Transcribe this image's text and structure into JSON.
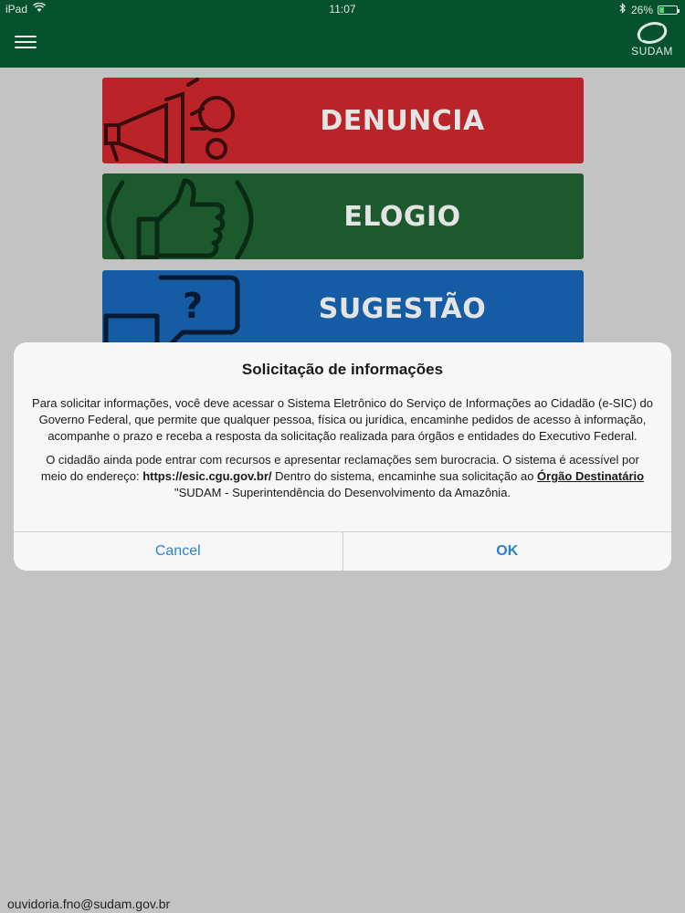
{
  "status_bar": {
    "carrier": "iPad",
    "time": "11:07",
    "battery": "26%",
    "battery_level": 0.26
  },
  "header": {
    "menu_icon": "hamburger-menu-icon",
    "logo_text": "SUDAM"
  },
  "tiles": [
    {
      "label": "DENUNCIA",
      "icon": "megaphone-icon",
      "color": "#ba2428"
    },
    {
      "label": "ELOGIO",
      "icon": "thumbs-up-icon",
      "color": "#1c5a2d"
    },
    {
      "label": "SUGESTÃO",
      "icon": "question-bubble-icon",
      "color": "#155ca4"
    }
  ],
  "alert": {
    "title": "Solicitação de informações",
    "paragraph1": "Para solicitar informações, você deve acessar o Sistema Eletrônico do Serviço de Informações ao Cidadão (e-SIC) do Governo Federal, que permite que qualquer pessoa, física ou jurídica, encaminhe pedidos de acesso à informação, acompanhe o prazo e receba a resposta da solicitação realizada para órgãos e entidades do Executivo Federal.",
    "paragraph2_prefix": "O cidadão ainda pode entrar com recursos e apresentar reclamações sem burocracia. O sistema é acessível por meio do endereço: ",
    "paragraph2_link": "https://esic.cgu.gov.br/",
    "paragraph2_middle": " Dentro do sistema, encaminhe sua solicitação ao ",
    "paragraph2_highlight": "Órgão Destinatário",
    "paragraph2_suffix": " \"SUDAM - Superintendência do Desenvolvimento da Amazônia.",
    "cancel_label": "Cancel",
    "ok_label": "OK",
    "button_color": "#2a82d6"
  },
  "footer": {
    "email": "ouvidoria.fno@sudam.gov.br"
  }
}
